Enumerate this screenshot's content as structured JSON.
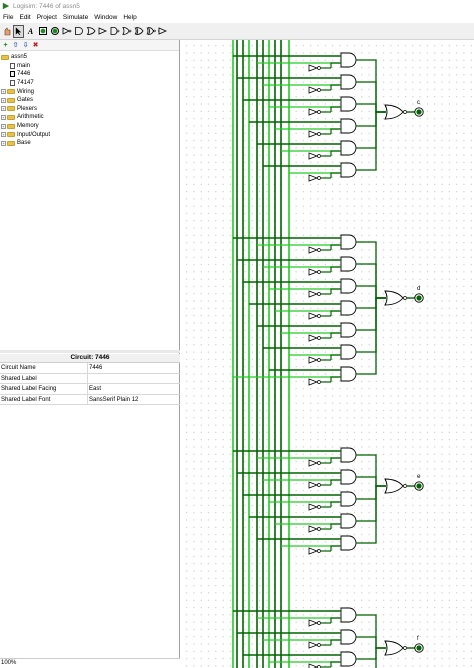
{
  "window": {
    "title": "Logisim: 7446 of assn5"
  },
  "menu": [
    "File",
    "Edit",
    "Project",
    "Simulate",
    "Window",
    "Help"
  ],
  "toolbar": {
    "text_tool": "A"
  },
  "tree": {
    "project": "assn5",
    "circuits": [
      "main",
      "7446",
      "74147"
    ],
    "libraries": [
      "Wiring",
      "Gates",
      "Plexers",
      "Arithmetic",
      "Memory",
      "Input/Output",
      "Base"
    ]
  },
  "attributes": {
    "title": "Circuit: 7446",
    "rows": [
      {
        "key": "Circuit Name",
        "value": "7446"
      },
      {
        "key": "Shared Label",
        "value": ""
      },
      {
        "key": "Shared Label Facing",
        "value": "East"
      },
      {
        "key": "Shared Label Font",
        "value": "SansSerif Plain 12"
      }
    ]
  },
  "status": {
    "zoom": "100%"
  },
  "canvas": {
    "outputs": [
      "c",
      "d",
      "e",
      "f"
    ]
  },
  "colors": {
    "wire_dark": "#006400",
    "wire_bright": "#22cc22",
    "wire_black": "#000000",
    "folder": "#e8c14a"
  }
}
